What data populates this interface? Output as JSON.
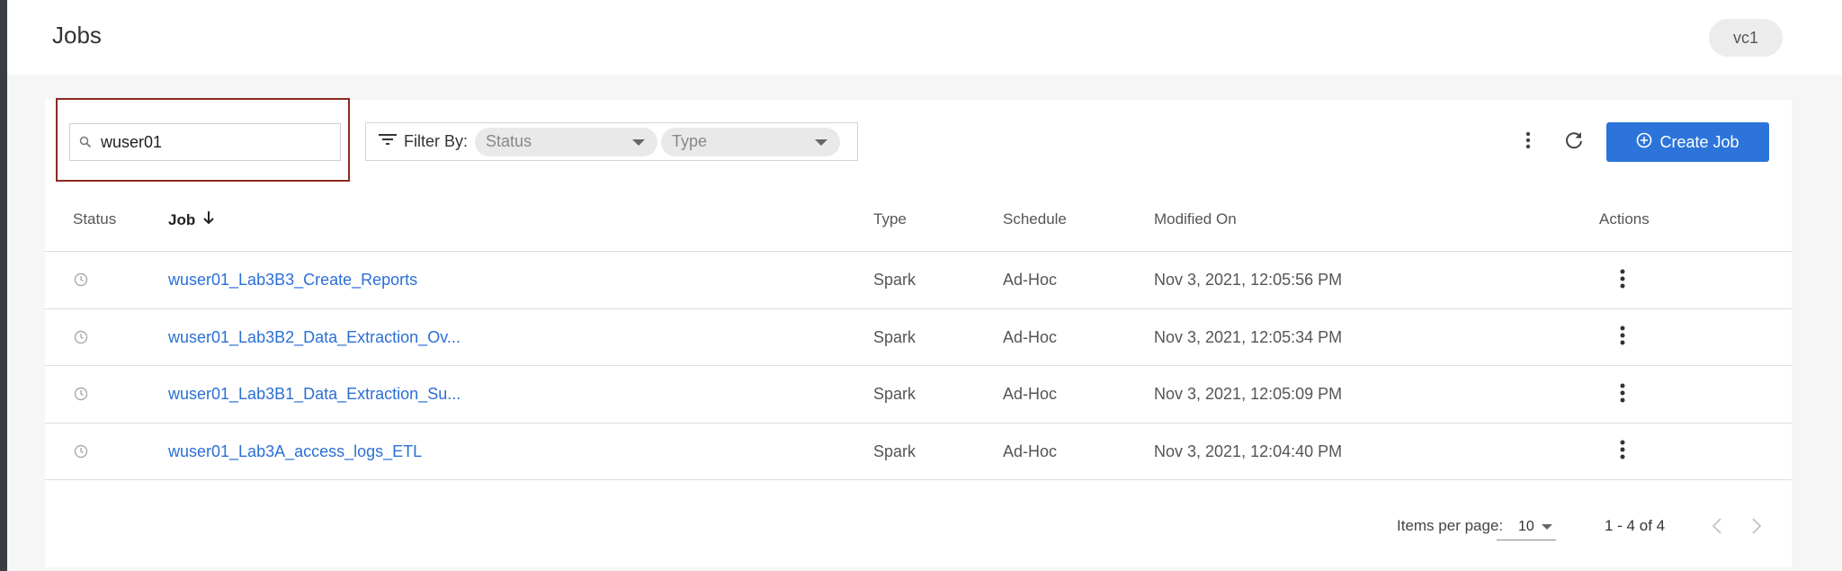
{
  "header": {
    "title": "Jobs",
    "virtual_cluster": "vc1"
  },
  "toolbar": {
    "search_value": "wuser01",
    "filter_label": "Filter By:",
    "filter_status_placeholder": "Status",
    "filter_type_placeholder": "Type",
    "create_label": "Create Job",
    "accent_color": "#2d74da",
    "highlight_color": "#8b2a20"
  },
  "table": {
    "columns": {
      "status": "Status",
      "job": "Job",
      "type": "Type",
      "schedule": "Schedule",
      "modified": "Modified On",
      "actions": "Actions"
    },
    "rows": [
      {
        "status_icon": "clock-icon",
        "job": "wuser01_Lab3B3_Create_Reports",
        "type": "Spark",
        "schedule": "Ad-Hoc",
        "modified": "Nov 3, 2021, 12:05:56 PM"
      },
      {
        "status_icon": "clock-icon",
        "job": "wuser01_Lab3B2_Data_Extraction_Ov...",
        "type": "Spark",
        "schedule": "Ad-Hoc",
        "modified": "Nov 3, 2021, 12:05:34 PM"
      },
      {
        "status_icon": "clock-icon",
        "job": "wuser01_Lab3B1_Data_Extraction_Su...",
        "type": "Spark",
        "schedule": "Ad-Hoc",
        "modified": "Nov 3, 2021, 12:05:09 PM"
      },
      {
        "status_icon": "clock-icon",
        "job": "wuser01_Lab3A_access_logs_ETL",
        "type": "Spark",
        "schedule": "Ad-Hoc",
        "modified": "Nov 3, 2021, 12:04:40 PM"
      }
    ]
  },
  "pagination": {
    "items_label": "Items per page:",
    "items_value": "10",
    "range": "1 - 4 of 4"
  }
}
